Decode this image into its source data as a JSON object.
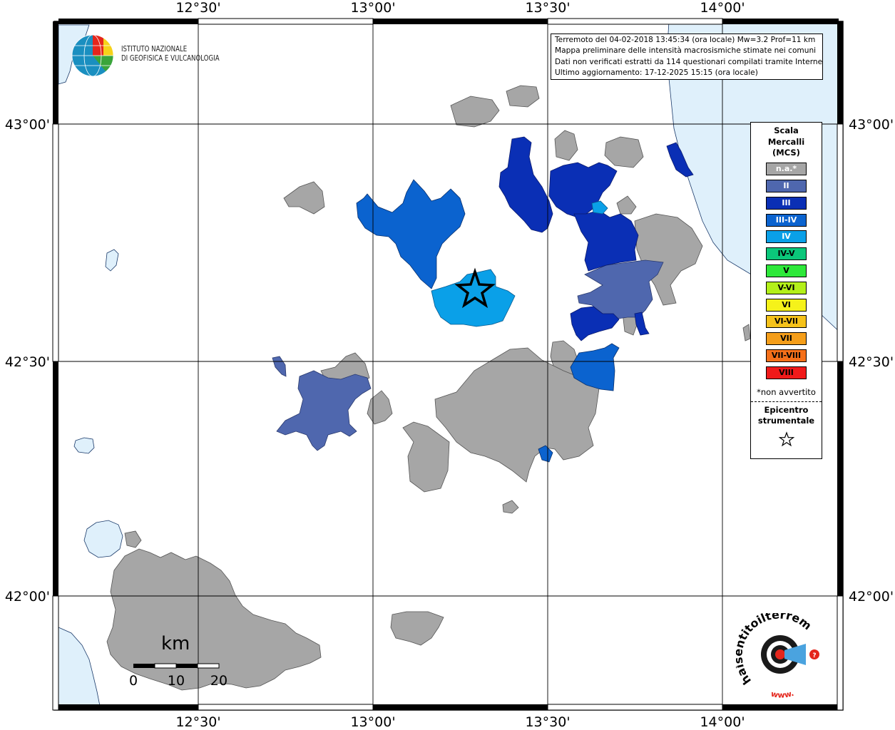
{
  "info": {
    "line1": "Terremoto del 04-02-2018 13:45:34 (ora locale) Mw=3.2 Prof=11 km",
    "line2": "Mappa preliminare delle intensità macrosismiche stimate nei comuni",
    "line3": "Dati non verificati estratti da 114 questionari compilati tramite Internet.",
    "line4": "Ultimo aggiornamento: 17-12-2025 15:15 (ora locale)"
  },
  "logo": {
    "line1": "ISTITUTO NAZIONALE",
    "line2": "DI GEOFISICA E VULCANOLOGIA"
  },
  "axes": {
    "longitudes": [
      "12°30'",
      "13°00'",
      "13°30'",
      "14°00'"
    ],
    "latitudes": [
      "43°00'",
      "42°30'",
      "42°00'"
    ]
  },
  "legend": {
    "title_line1": "Scala",
    "title_line2": "Mercalli",
    "title_line3": "(MCS)",
    "items": [
      {
        "label": "n.a.*",
        "color": "#a6a6a6",
        "light": true
      },
      {
        "label": "II",
        "color": "#4f67ae",
        "light": true
      },
      {
        "label": "III",
        "color": "#0a2fb5",
        "light": true
      },
      {
        "label": "III-IV",
        "color": "#0b63cf",
        "light": true
      },
      {
        "label": "IV",
        "color": "#0aa0e8",
        "light": true
      },
      {
        "label": "IV-V",
        "color": "#0bc77a",
        "light": false
      },
      {
        "label": "V",
        "color": "#2ee83a",
        "light": false
      },
      {
        "label": "V-VI",
        "color": "#b3f01a",
        "light": false
      },
      {
        "label": "VI",
        "color": "#f5f21a",
        "light": false
      },
      {
        "label": "VI-VII",
        "color": "#f5c21a",
        "light": false
      },
      {
        "label": "VII",
        "color": "#f59e1a",
        "light": false
      },
      {
        "label": "VII-VIII",
        "color": "#f5701a",
        "light": false
      },
      {
        "label": "VIII",
        "color": "#f01a1a",
        "light": false
      }
    ],
    "note": "*non avvertito",
    "epicentro_line1": "Epicentro",
    "epicentro_line2": "strumentale",
    "star_glyph": "☆"
  },
  "scale_bar": {
    "unit": "km",
    "labels": [
      "0",
      "10",
      "20"
    ]
  },
  "brand": {
    "text": "haisentitoilterremoto.it",
    "www": "www."
  },
  "colors": {
    "sea": "#dff0fb",
    "na": "#a6a6a6",
    "II": "#4f67ae",
    "III": "#0a2fb5",
    "III-IV": "#0b63cf",
    "IV": "#0aa0e8"
  }
}
